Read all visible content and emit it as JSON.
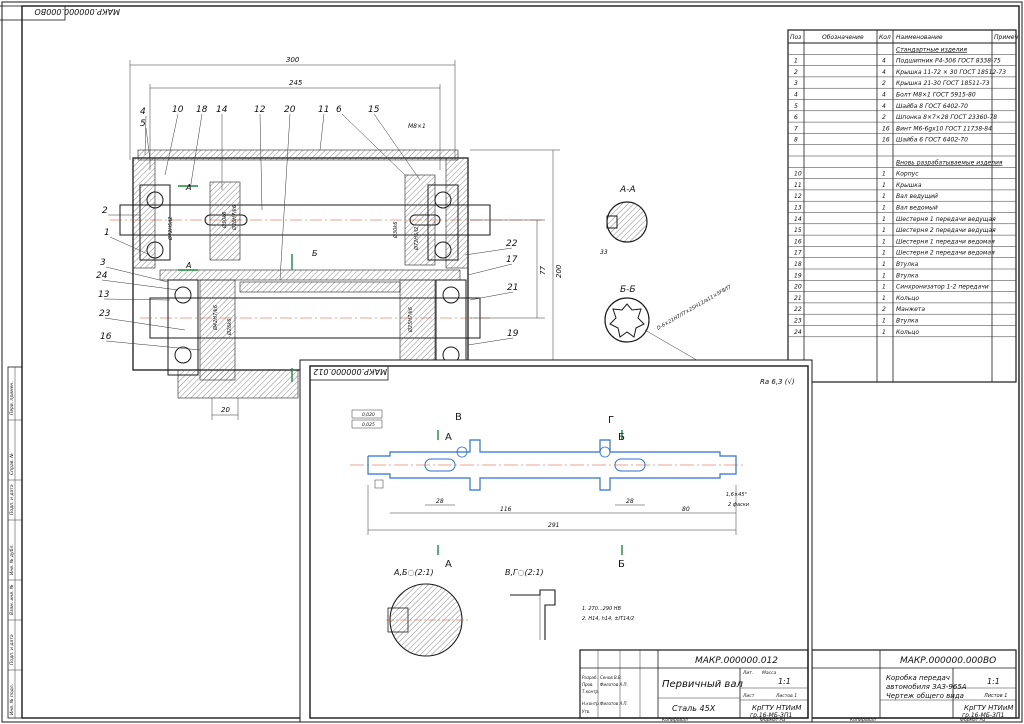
{
  "assembly": {
    "stamp_code": "МАКР.000000.000ВО",
    "dims": {
      "overall_width": "300",
      "inner_width": "245",
      "thread": "М8×1",
      "height1": "200",
      "height2": "77",
      "offset": "20"
    },
    "callouts": [
      "1",
      "2",
      "3",
      "24",
      "13",
      "23",
      "16",
      "4",
      "5",
      "10",
      "18",
      "14",
      "12",
      "20",
      "11",
      "6",
      "15",
      "22",
      "17",
      "21",
      "19"
    ],
    "section_marks": {
      "a": "А",
      "b": "Б"
    },
    "section_aa": {
      "title": "А-А",
      "d1": "8",
      "d2": "33"
    },
    "section_bb": {
      "title": "Б-Б",
      "spline": "D-6×21Н7/f7×25Н12/а11×5F8/f7"
    },
    "diameters": [
      "Ø72Н5/l2",
      "Ø30k6",
      "Ø26Н7/k6",
      "Ø42Н7/k6",
      "Ø26k6",
      "Ø25Н7/k6",
      "Ø30k6",
      "Ø72Н5/l2"
    ]
  },
  "spec_table": {
    "headers": [
      "Поз",
      "Обозначение",
      "Кол",
      "Наименование",
      "Примеч"
    ],
    "section1": "Стандартные изделия",
    "rows1": [
      {
        "pos": "1",
        "qty": "4",
        "name": "Подшипник Р4-306 ГОСТ 8338-75"
      },
      {
        "pos": "2",
        "qty": "4",
        "name": "Крышка 11-72 × 30 ГОСТ 18512-73"
      },
      {
        "pos": "3",
        "qty": "2",
        "name": "Крышка 21-30 ГОСТ 18511-73"
      },
      {
        "pos": "4",
        "qty": "4",
        "name": "Болт М8×1 ГОСТ 5915-80"
      },
      {
        "pos": "5",
        "qty": "4",
        "name": "Шайба 8 ГОСТ 6402-70"
      },
      {
        "pos": "6",
        "qty": "2",
        "name": "Шпонка 8×7×28 ГОСТ 23360-78"
      },
      {
        "pos": "7",
        "qty": "16",
        "name": "Винт М6-6gх10 ГОСТ 11738-84"
      },
      {
        "pos": "8",
        "qty": "16",
        "name": "Шайба 6 ГОСТ 6402-70"
      }
    ],
    "section2": "Вновь разрабатываемые изделия",
    "rows2": [
      {
        "pos": "10",
        "qty": "1",
        "name": "Корпус"
      },
      {
        "pos": "11",
        "qty": "1",
        "name": "Крышка"
      },
      {
        "pos": "12",
        "qty": "1",
        "name": "Вал ведущий"
      },
      {
        "pos": "13",
        "qty": "1",
        "name": "Вал ведомый"
      },
      {
        "pos": "14",
        "qty": "1",
        "name": "Шестерня 1 передачи ведущая"
      },
      {
        "pos": "15",
        "qty": "1",
        "name": "Шестерня 2 передачи ведущая"
      },
      {
        "pos": "16",
        "qty": "1",
        "name": "Шестерня 1 передачи ведомая"
      },
      {
        "pos": "17",
        "qty": "1",
        "name": "Шестерня 2 передачи ведомая"
      },
      {
        "pos": "18",
        "qty": "1",
        "name": "Втулка"
      },
      {
        "pos": "19",
        "qty": "1",
        "name": "Втулка"
      },
      {
        "pos": "20",
        "qty": "1",
        "name": "Синхронизатор 1-2 передачи"
      },
      {
        "pos": "21",
        "qty": "1",
        "name": "Кольцо"
      },
      {
        "pos": "22",
        "qty": "2",
        "name": "Манжета"
      },
      {
        "pos": "23",
        "qty": "1",
        "name": "Втулка"
      },
      {
        "pos": "24",
        "qty": "1",
        "name": "Кольцо"
      }
    ]
  },
  "shaft_sheet": {
    "stamp_code": "МАКР.000000.012",
    "roughness": "Ra 6,3 (√)",
    "marks": [
      "В",
      "А",
      "Г",
      "Б"
    ],
    "dims": {
      "total": "291",
      "seg1": "116",
      "seg2": "28",
      "seg3": "28",
      "seg4": "80",
      "chamfer": "1,6×45°",
      "chamfer_note": "2 фаски"
    },
    "tolerance": [
      "0,020",
      "0,025"
    ],
    "detail_ab": "А,Б◌(2:1)",
    "detail_vg": "В,Г◌(2:1)",
    "notes": [
      "1. 270...290 НВ",
      "2. Н14, h14, ±IT14/2"
    ],
    "title_block": {
      "code": "МАКР.000000.012",
      "name": "Первичный вал",
      "material": "Сталь 45Х",
      "scale": "1:1",
      "org": "КрГТУ НТИиМ",
      "group": "гр.16-МБ-3П1",
      "sheet": "Лист",
      "sheets": "Листов 1",
      "mass": "Масса",
      "lit": "Лит.",
      "copied": "Копировал",
      "format": "Формат А3",
      "roles": [
        "Разраб.",
        "Пров.",
        "Т.контр.",
        "Н.контр.",
        "Утв."
      ],
      "people": [
        "Сенов В.В.",
        "Филатов А.П.",
        "Филатов А.П."
      ]
    }
  },
  "assembly_title_block": {
    "code": "МАКР.000000.000ВО",
    "name_lines": [
      "Коробка передач",
      "автомобиля ЗАЗ-965А",
      "Чертеж общего вида"
    ],
    "scale": "1:1",
    "org": "КрГТУ НТИиМ",
    "group": "гр.16-МБ-3П1",
    "sheets": "Листов 1",
    "copied": "Копировал",
    "format": "Формат А1"
  },
  "left_strip": [
    "Перв. примен.",
    "Справ. №",
    "Подп. и дата",
    "Инв. № дубл.",
    "Взам. инв. №",
    "Подп. и дата",
    "Инв. № подл."
  ],
  "colors": {
    "line": "#1a1a1a",
    "blue": "#2f6fd6",
    "green": "#1a8a3a",
    "hatch": "#444444"
  }
}
